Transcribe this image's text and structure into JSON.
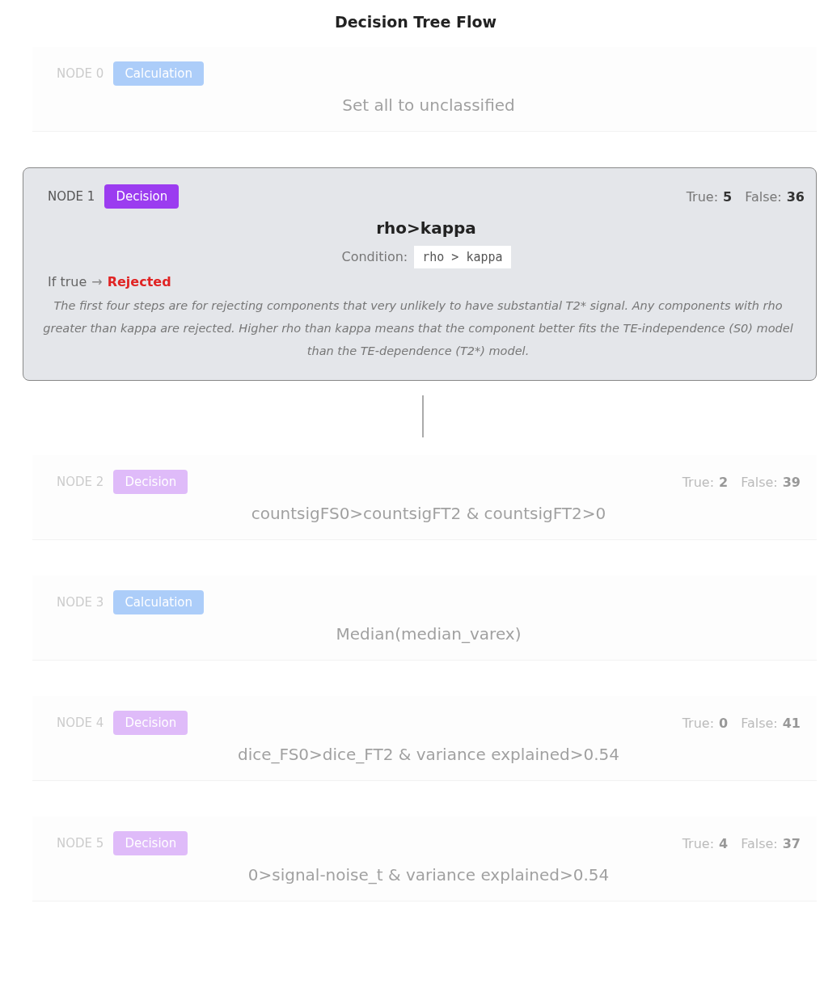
{
  "title": "Decision Tree Flow",
  "nodes": [
    {
      "label": "NODE 0",
      "kind": "calculation",
      "badge": "Calculation",
      "selected": false,
      "expression": "Set all to unclassified"
    },
    {
      "label": "NODE 1",
      "kind": "decision",
      "badge": "Decision",
      "selected": true,
      "true_label": "True:",
      "true_count": "5",
      "false_label": "False:",
      "false_count": "36",
      "expression": "rho>kappa",
      "condition_label": "Condition:",
      "condition": "rho > kappa",
      "outcome_label": "If true",
      "outcome_arrow": "→",
      "outcome": "Rejected",
      "description": "The first four steps are for rejecting components that very unlikely to have substantial T2* signal. Any components with rho greater than kappa are rejected. Higher rho than kappa means that the component better fits the TE-independence (S0) model than the TE-dependence (T2*) model."
    },
    {
      "label": "NODE 2",
      "kind": "decision",
      "badge": "Decision",
      "selected": false,
      "true_label": "True:",
      "true_count": "2",
      "false_label": "False:",
      "false_count": "39",
      "expression": "countsigFS0>countsigFT2 & countsigFT2>0"
    },
    {
      "label": "NODE 3",
      "kind": "calculation",
      "badge": "Calculation",
      "selected": false,
      "expression": "Median(median_varex)"
    },
    {
      "label": "NODE 4",
      "kind": "decision",
      "badge": "Decision",
      "selected": false,
      "true_label": "True:",
      "true_count": "0",
      "false_label": "False:",
      "false_count": "41",
      "expression": "dice_FS0>dice_FT2 & variance explained>0.54"
    },
    {
      "label": "NODE 5",
      "kind": "decision",
      "badge": "Decision",
      "selected": false,
      "true_label": "True:",
      "true_count": "4",
      "false_label": "False:",
      "false_count": "37",
      "expression": "0>signal-noise_t & variance explained>0.54"
    }
  ]
}
